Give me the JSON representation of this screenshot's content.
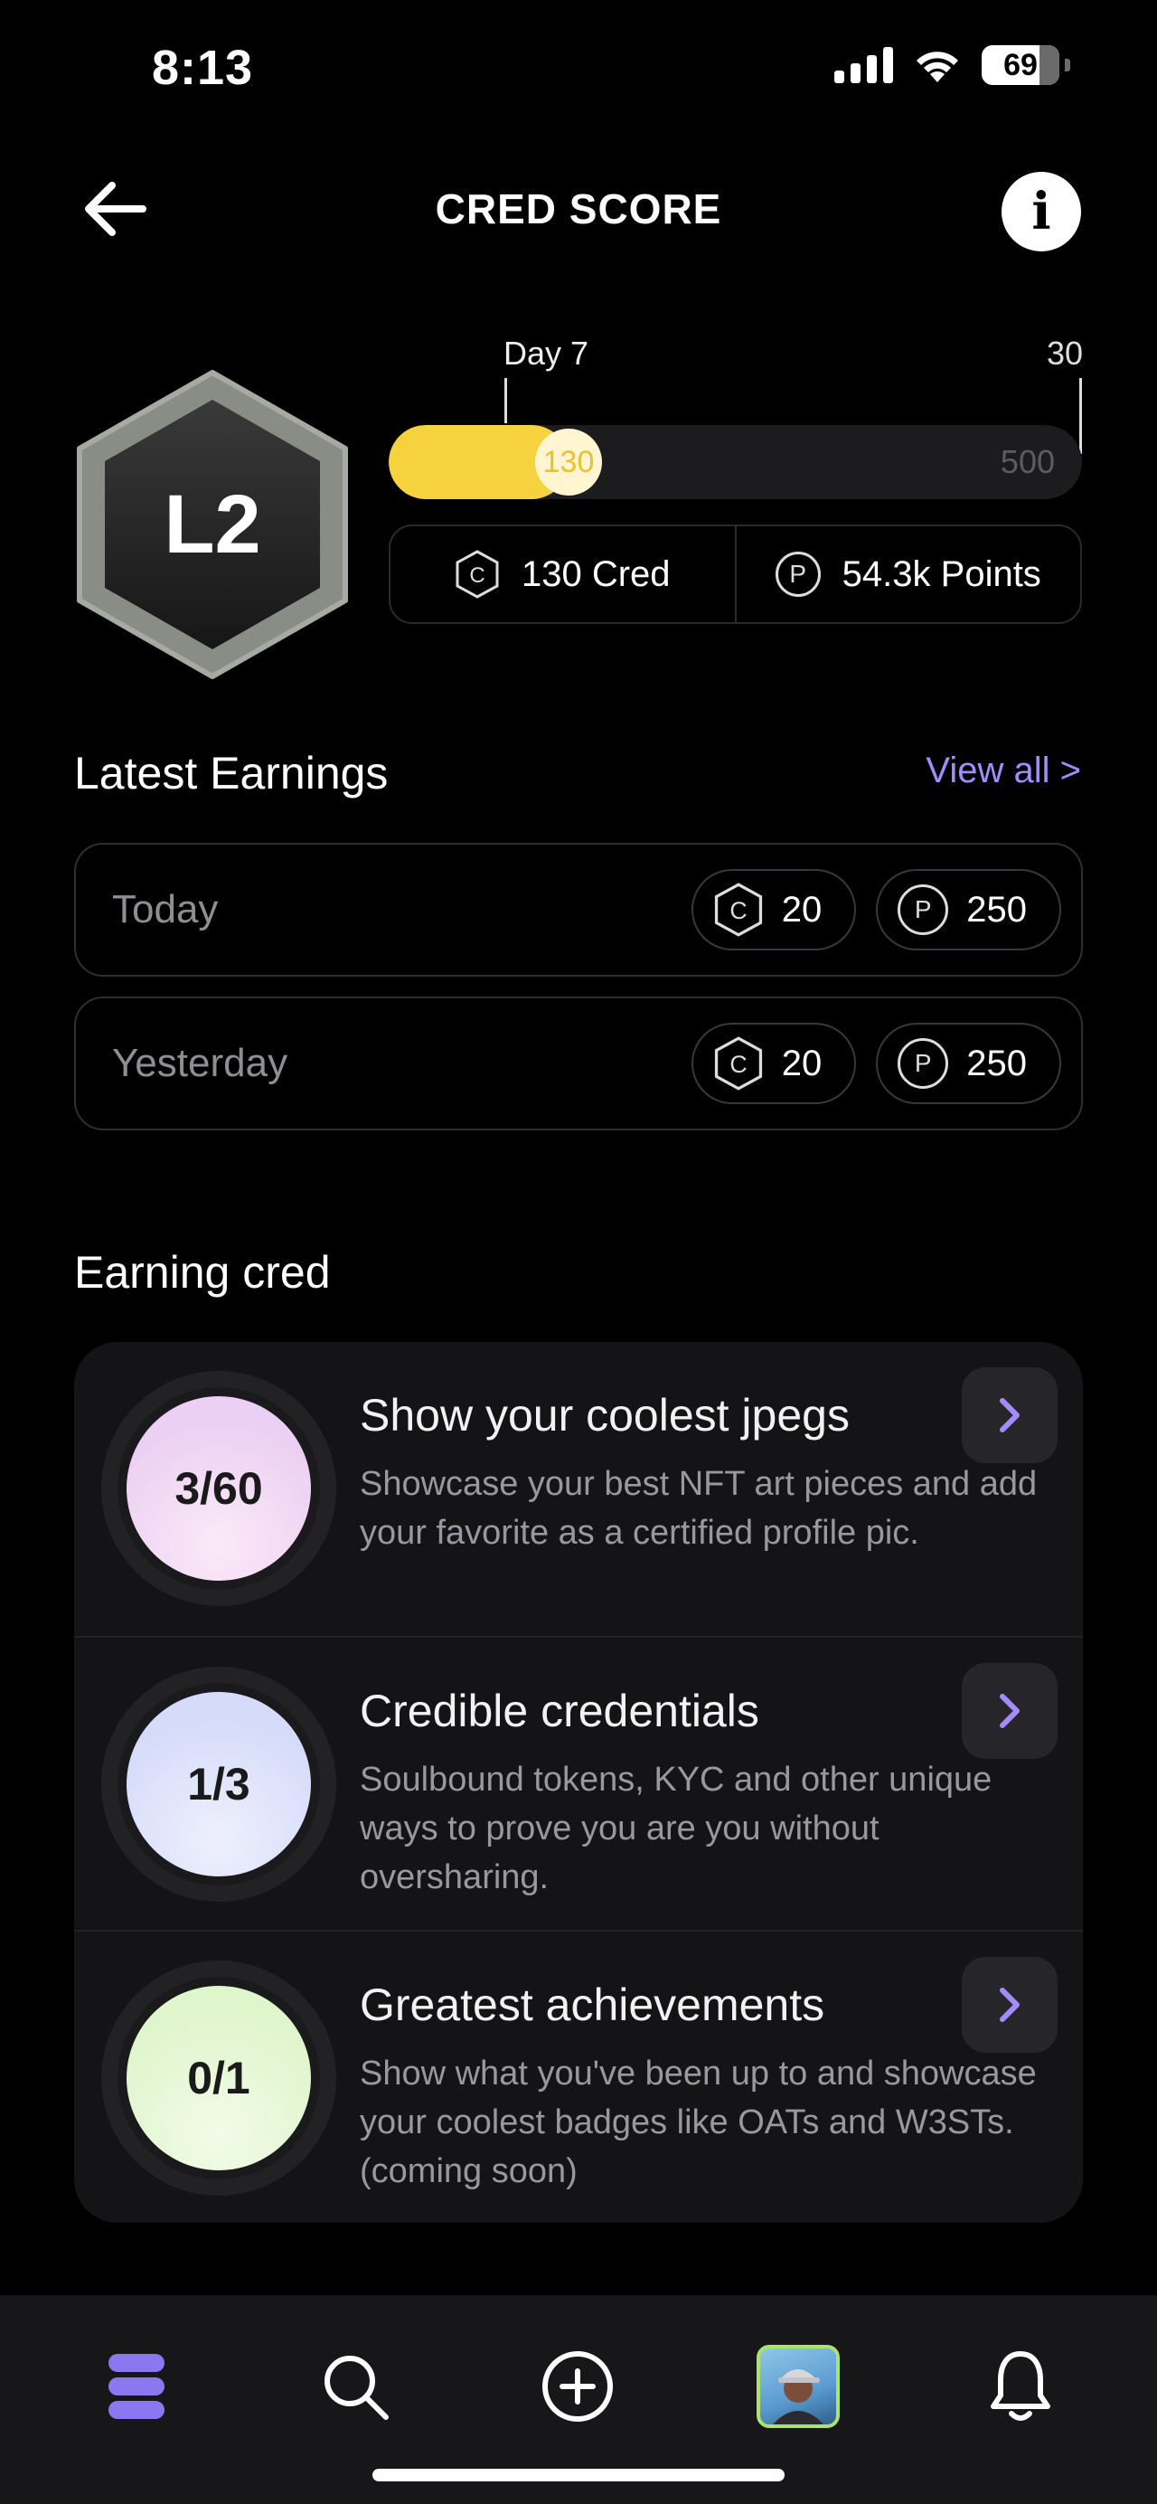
{
  "status_bar": {
    "time": "8:13",
    "battery": "69"
  },
  "header": {
    "title": "CRED SCORE"
  },
  "level": {
    "label": "L2"
  },
  "progress": {
    "day_label": "Day 7",
    "day_max": "30",
    "current": "130",
    "max": "500",
    "fraction": 0.26
  },
  "stats": {
    "cred": "130 Cred",
    "points": "54.3k Points"
  },
  "latest_earnings": {
    "title": "Latest Earnings",
    "view_all": "View all >",
    "rows": [
      {
        "label": "Today",
        "cred": "20",
        "points": "250"
      },
      {
        "label": "Yesterday",
        "cred": "20",
        "points": "250"
      }
    ]
  },
  "earning_cred": {
    "title": "Earning cred",
    "items": [
      {
        "progress": "3/60",
        "title": "Show your coolest jpegs",
        "description": "Showcase your best NFT art pieces and add your favorite as a certified profile pic.",
        "color": "#f1d6f5"
      },
      {
        "progress": "1/3",
        "title": "Credible credentials",
        "description": "Soulbound tokens, KYC and other unique ways to prove you are you without oversharing.",
        "color": "#dfe3fb"
      },
      {
        "progress": "0/1",
        "title": "Greatest achievements",
        "description": "Show what you've been up to and showcase your coolest badges like OATs and W3STs. (coming soon)",
        "color": "#e8f8d8"
      }
    ]
  },
  "icons": {
    "cred": "C",
    "points": "P",
    "info": "i"
  },
  "colors": {
    "accent": "#a48bff",
    "progress": "#f6d33e",
    "avatar_border": "#aee26b"
  }
}
